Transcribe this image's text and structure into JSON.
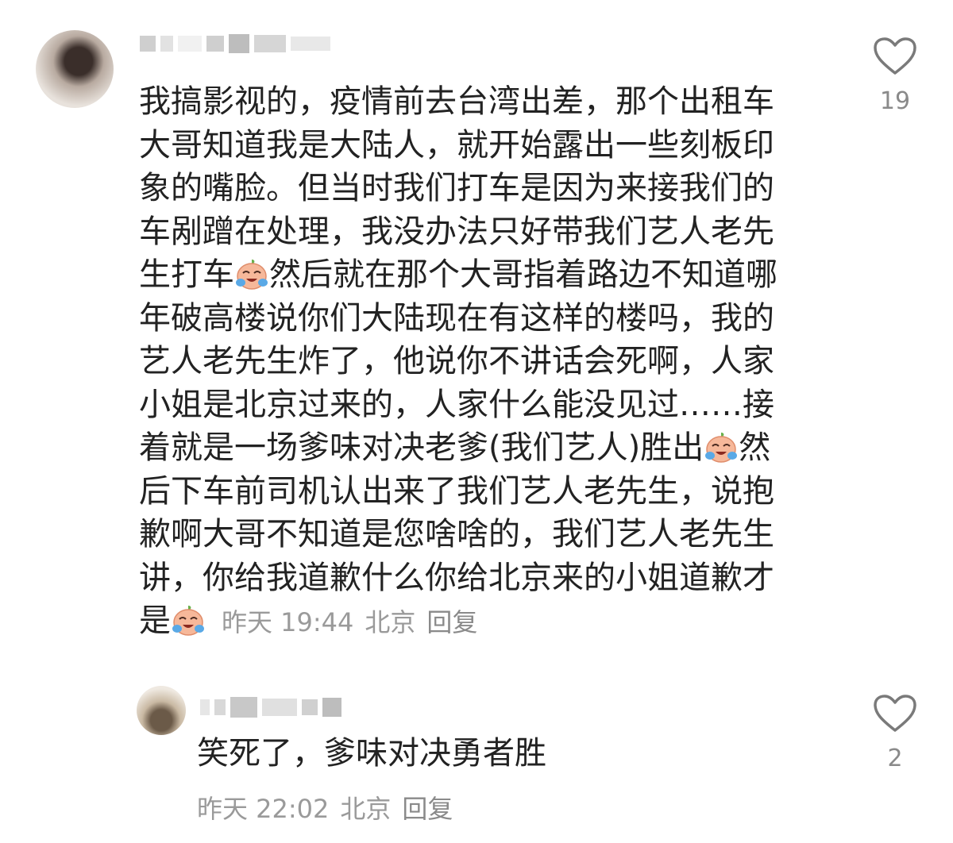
{
  "comments": [
    {
      "lines": [
        "我搞影视的，疫情前去台湾出差，那个出租车",
        "大哥知道我是大陆人，就开始露出一些刻板印",
        "象的嘴脸。但当时我们打车是因为来接我们的",
        "车剐蹭在处理，我没办法只好带我们艺人老先",
        [
          "生打车",
          "然后就在那个大哥指着路边不知道哪"
        ],
        "年破高楼说你们大陆现在有这样的楼吗，我的",
        "艺人老先生炸了，他说你不讲话会死啊，人家",
        "小姐是北京过来的，人家什么能没见过……接",
        [
          "着就是一场爹味对决老爹(我们艺人)胜出",
          "然"
        ],
        "后下车前司机认出来了我们艺人老先生，说抱",
        "歉啊大哥不知道是您啥啥的，我们艺人老先生",
        "讲，你给我道歉什么你给北京来的小姐道歉才"
      ],
      "last_line_text": "是",
      "time": "昨天 19:44",
      "location": "北京",
      "reply_label": "回复",
      "like_count": "19",
      "emoji_icon": "crying-laughing-emoji-icon"
    },
    {
      "text": "笑死了，爹味对决勇者胜",
      "time": "昨天 22:02",
      "location": "北京",
      "reply_label": "回复",
      "like_count": "2"
    }
  ],
  "colors": {
    "text": "#222222",
    "meta": "#9a9a9a",
    "heart_stroke": "#7a7a7a"
  }
}
